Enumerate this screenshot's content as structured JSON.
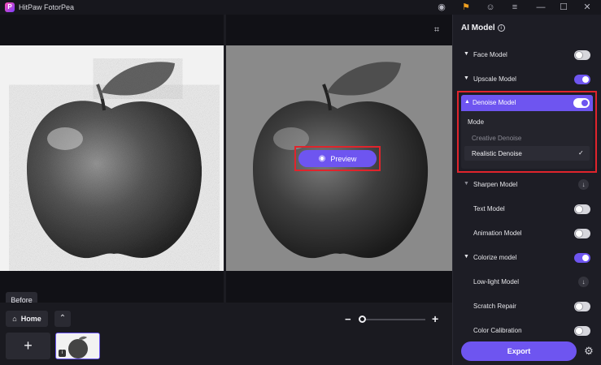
{
  "app": {
    "title": "HitPaw FotorPea",
    "logo_letter": "P"
  },
  "titlebar": {
    "icons": [
      "discord-icon",
      "gift-icon",
      "account-icon",
      "menu-icon",
      "minimize-icon",
      "maximize-icon",
      "close-icon"
    ],
    "glyphs": {
      "discord": "◉",
      "gift": "⚑",
      "account": "☺",
      "menu": "≡",
      "minimize": "—",
      "maximize": "☐",
      "close": "✕"
    }
  },
  "canvas": {
    "before_label": "Before",
    "preview_label": "Preview",
    "eye_glyph": "◉",
    "crop_glyph": "⌗"
  },
  "bottom": {
    "home_label": "Home",
    "home_glyph": "⌂",
    "up_glyph": "⌃",
    "add_glyph": "+",
    "zoom_minus": "−",
    "zoom_plus": "+",
    "zoom_level": 0
  },
  "panel": {
    "title": "AI Model",
    "info_glyph": "i",
    "models": [
      {
        "label": "Face Model",
        "state": "off",
        "expandable": true
      },
      {
        "label": "Upscale Model",
        "state": "on",
        "expandable": true
      }
    ],
    "denoise": {
      "label": "Denoise Model",
      "state": "on",
      "mode_label": "Mode",
      "options": [
        {
          "label": "Creative Denoise",
          "selected": false
        },
        {
          "label": "Realistic Denoise",
          "selected": true
        }
      ],
      "check_glyph": "✓"
    },
    "models_after": [
      {
        "label": "Sharpen Model",
        "state": "download",
        "expandable": true
      },
      {
        "label": "Text Model",
        "state": "off",
        "expandable": false
      },
      {
        "label": "Animation Model",
        "state": "off",
        "expandable": false
      },
      {
        "label": "Colorize model",
        "state": "on",
        "expandable": true
      },
      {
        "label": "Low-light Model",
        "state": "download",
        "expandable": false
      },
      {
        "label": "Scratch Repair",
        "state": "off",
        "expandable": false
      },
      {
        "label": "Color Calibration",
        "state": "off",
        "expandable": false
      }
    ],
    "download_glyph": "↓",
    "caret_down": "▼",
    "caret_up": "▲",
    "export_label": "Export",
    "gear_glyph": "⚙"
  },
  "colors": {
    "accent": "#6e55f0",
    "highlight": "#e0242c",
    "panel_bg": "#1d1d25"
  }
}
